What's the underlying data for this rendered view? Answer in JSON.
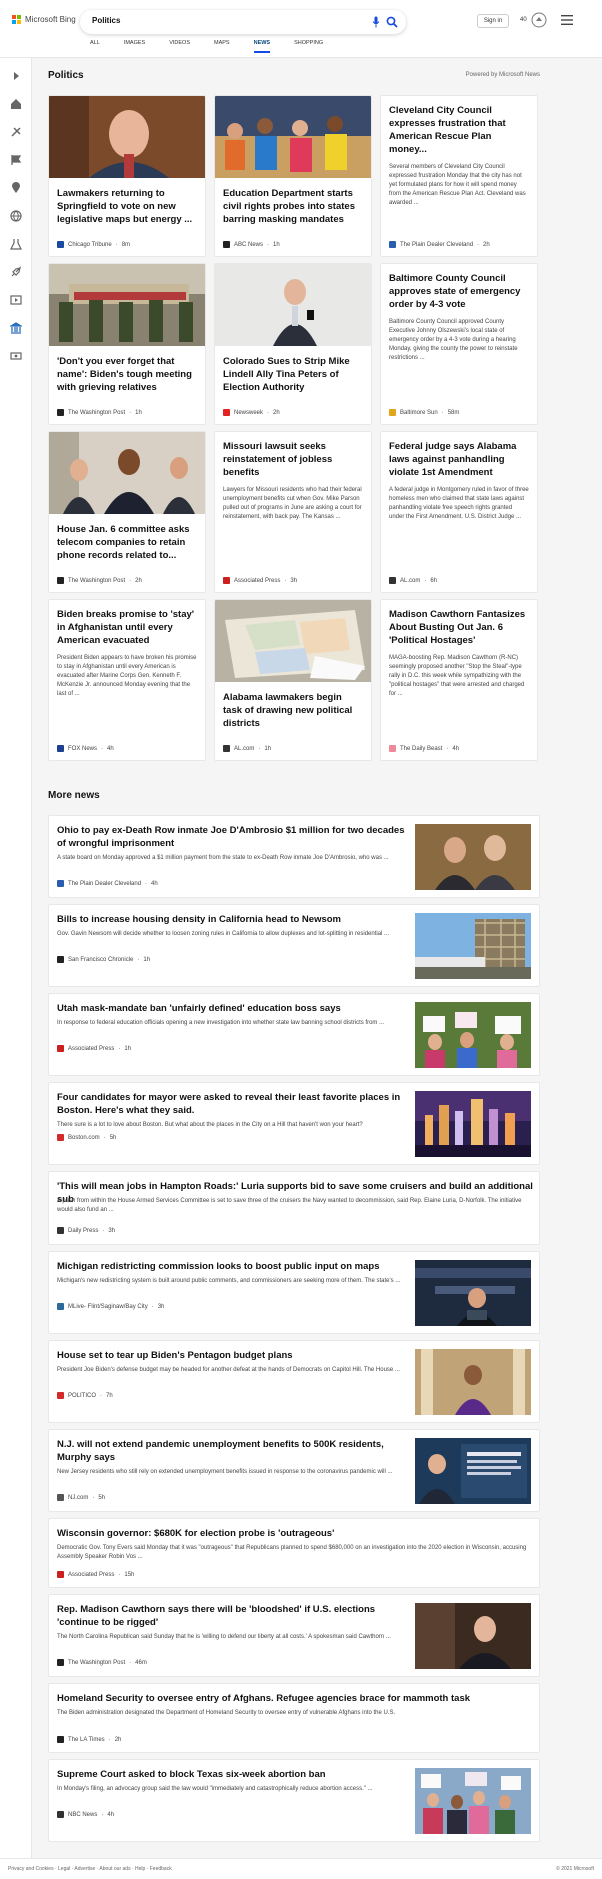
{
  "header": {
    "brand": "Microsoft Bing",
    "search_value": "Politics",
    "signin": "Sign in",
    "rewards_count": "40",
    "tabs": [
      "ALL",
      "IMAGES",
      "VIDEOS",
      "MAPS",
      "NEWS",
      "SHOPPING"
    ],
    "active_tab": "NEWS"
  },
  "politics": {
    "title": "Politics",
    "powered": "Powered by Microsoft News",
    "cards": [
      {
        "title": "Lawmakers returning to Springfield to vote on new legislative maps but energy ...",
        "snippet": "",
        "source": "Chicago Tribune",
        "time": "8m",
        "logo_color": "#1a4ba0"
      },
      {
        "title": "Education Department starts civil rights probes into states barring masking mandates",
        "snippet": "",
        "source": "ABC News",
        "time": "1h",
        "logo_color": "#222222"
      },
      {
        "title": "Cleveland City Council expresses frustration that American Rescue Plan money...",
        "snippet": "Several members of Cleveland City Council expressed frustration Monday that the city has not yet formulated plans for how it will spend money from the American Rescue Plan Act. Cleveland was awarded ...",
        "source": "The Plain Dealer Cleveland",
        "time": "2h",
        "logo_color": "#2a5db0"
      },
      {
        "title": "'Don't you ever forget that name': Biden's tough meeting with grieving relatives",
        "snippet": "",
        "source": "The Washington Post",
        "time": "1h",
        "logo_color": "#222222"
      },
      {
        "title": "Colorado Sues to Strip Mike Lindell Ally Tina Peters of Election Authority",
        "snippet": "",
        "source": "Newsweek",
        "time": "2h",
        "logo_color": "#e32222"
      },
      {
        "title": "Baltimore County Council approves state of emergency order by 4-3 vote",
        "snippet": "Baltimore County Council approved County Executive Johnny Olszewski's local state of emergency order by a 4-3 vote during a hearing Monday, giving the county the power to reinstate restrictions ...",
        "source": "Baltimore Sun",
        "time": "58m",
        "logo_color": "#e3a51a"
      },
      {
        "title": "House Jan. 6 committee asks telecom companies to retain phone records related to...",
        "snippet": "",
        "source": "The Washington Post",
        "time": "2h",
        "logo_color": "#222222"
      },
      {
        "title": "Missouri lawsuit seeks reinstatement of jobless benefits",
        "snippet": "Lawyers for Missouri residents who had their federal unemployment benefits cut when Gov. Mike Parson pulled out of programs in June are asking a court for reinstatement, with back pay. The Kansas ...",
        "source": "Associated Press",
        "time": "3h",
        "logo_color": "#cc1f1f"
      },
      {
        "title": "Federal judge says Alabama laws against panhandling violate 1st Amendment",
        "snippet": "A federal judge in Montgomery ruled in favor of three homeless men who claimed that state laws against panhandling violate free speech rights granted under the First Amendment. U.S. District Judge ...",
        "source": "AL.com",
        "time": "6h",
        "logo_color": "#333333"
      },
      {
        "title": "Biden breaks promise to 'stay' in Afghanistan until every American evacuated",
        "snippet": "President Biden appears to have broken his promise to stay in Afghanistan until every American is evacuated after Marine Corps Gen. Kenneth F. McKenzie Jr. announced Monday evening that the last of ...",
        "source": "FOX News",
        "time": "4h",
        "logo_color": "#1d3f8f"
      },
      {
        "title": "Alabama lawmakers begin task of drawing new political districts",
        "snippet": "",
        "source": "AL.com",
        "time": "1h",
        "logo_color": "#333333"
      },
      {
        "title": "Madison Cawthorn Fantasizes About Busting Out Jan. 6 'Political Hostages'",
        "snippet": "MAGA-boosting Rep. Madison Cawthorn (R-NC) seemingly proposed another \"Stop the Steal\"-type rally in D.C. this week while sympathizing with the \"political hostages\" that were arrested and charged for ...",
        "source": "The Daily Beast",
        "time": "4h",
        "logo_color": "#f08a9a"
      }
    ]
  },
  "more_news": {
    "title": "More news",
    "items": [
      {
        "title": "Ohio to pay ex-Death Row inmate Joe D'Ambrosio $1 million for two decades of wrongful imprisonment",
        "snippet": "A state board on Monday approved a $1 million payment from the state to ex-Death Row inmate Joe D'Ambrosio, who was ...",
        "source": "The Plain Dealer Cleveland",
        "time": "4h",
        "logo_color": "#2a5db0"
      },
      {
        "title": "Bills to increase housing density in California head to Newsom",
        "snippet": "Gov. Gavin Newsom will decide whether to loosen zoning rules in California to allow duplexes and lot-splitting in residential ...",
        "source": "San Francisco Chronicle",
        "time": "1h",
        "logo_color": "#222222"
      },
      {
        "title": "Utah mask-mandate ban 'unfairly defined' education boss says",
        "snippet": "In response to federal education officials opening a new investigation into whether state law banning school districts from ...",
        "source": "Associated Press",
        "time": "1h",
        "logo_color": "#cc1f1f"
      },
      {
        "title": "Four candidates for mayor were asked to reveal their least favorite places in Boston. Here's what they said.",
        "snippet": "There sure is a lot to love about Boston. But what about the places in the City on a Hill that haven't won your heart?",
        "source": "Boston.com",
        "time": "5h",
        "logo_color": "#d22a2a"
      },
      {
        "title": "'This will mean jobs in Hampton Roads:' Luria supports bid to save some cruisers and build an additional sub",
        "snippet": "A push from within the House Armed Services Committee is set to save three of the cruisers the Navy wanted to decommission, said Rep. Elaine Luria, D-Norfolk. The initiative would also fund an ...",
        "source": "Daily Press",
        "time": "3h",
        "logo_color": "#333333"
      },
      {
        "title": "Michigan redistricting commission looks to boost public input on maps",
        "snippet": "Michigan's new redistricting system is built around public comments, and commissioners are seeking more of them. The state's ...",
        "source": "MLive- Flint/Saginaw/Bay City",
        "time": "3h",
        "logo_color": "#2b6a9a"
      },
      {
        "title": "House set to tear up Biden's Pentagon budget plans",
        "snippet": "President Joe Biden's defense budget may be headed for another defeat at the hands of Democrats on Capitol Hill. The House ...",
        "source": "POLITICO",
        "time": "7h",
        "logo_color": "#d42a2a"
      },
      {
        "title": "N.J. will not extend pandemic unemployment benefits to 500K residents, Murphy says",
        "snippet": "New Jersey residents who still rely on extended unemployment benefits issued in response to the coronavirus pandemic will ...",
        "source": "NJ.com",
        "time": "5h",
        "logo_color": "#555555"
      },
      {
        "title": "Wisconsin governor: $680K for election probe is 'outrageous'",
        "snippet": "Democratic Gov. Tony Evers said Monday that it was \"outrageous\" that Republicans planned to spend $680,000 on an investigation into the 2020 election in Wisconsin, accusing Assembly Speaker Robin Vos ...",
        "source": "Associated Press",
        "time": "15h",
        "logo_color": "#cc1f1f"
      },
      {
        "title": "Rep. Madison Cawthorn says there will be 'bloodshed' if U.S. elections 'continue to be rigged'",
        "snippet": "The North Carolina Republican said Sunday that he is 'willing to defend our liberty at all costs.' A spokesman said Cawthorn ...",
        "source": "The Washington Post",
        "time": "46m",
        "logo_color": "#222222"
      },
      {
        "title": "Homeland Security to oversee entry of Afghans. Refugee agencies brace for mammoth task",
        "snippet": "The Biden administration designated the Department of Homeland Security to oversee entry of vulnerable Afghans into the U.S.",
        "source": "The LA Times",
        "time": "2h",
        "logo_color": "#222222"
      },
      {
        "title": "Supreme Court asked to block Texas six-week abortion ban",
        "snippet": "In Monday's filing, an advocacy group said the law would \"immediately and catastrophically reduce abortion access.\" ...",
        "source": "NBC News",
        "time": "4h",
        "logo_color": "#333333"
      }
    ]
  },
  "footer": {
    "left": "Privacy and Cookies · Legal · Advertise · About our ads · Help · Feedback",
    "right": "© 2021 Microsoft"
  },
  "colors": {
    "accent": "#174ae4",
    "page_bg": "#f5f5f5"
  }
}
